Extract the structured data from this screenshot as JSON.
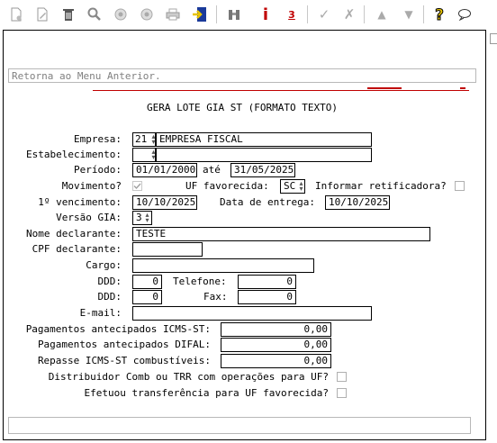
{
  "toolbar": {
    "icons": [
      "new-document-icon",
      "edit-icon",
      "trash-icon",
      "search-icon",
      "previous-icon",
      "next-icon",
      "print-icon",
      "exit-icon",
      "binoculars-icon",
      "info-icon",
      "sum-icon",
      "check-icon",
      "tools-icon",
      "up-arrow-icon",
      "down-arrow-icon",
      "help-icon",
      "chat-icon"
    ]
  },
  "message_bar": {
    "text": "Retorna ao Menu Anterior."
  },
  "form": {
    "title": "GERA LOTE GIA ST (FORMATO TEXTO)",
    "empresa": {
      "label": "Empresa:",
      "code": "21",
      "name": "EMPRESA FISCAL"
    },
    "estabelecimento": {
      "label": "Estabelecimento:",
      "code": "",
      "name": ""
    },
    "periodo": {
      "label": "Período:",
      "from": "01/01/2000",
      "sep": "até",
      "to": "31/05/2025"
    },
    "movimento": {
      "label": "Movimento?",
      "checked": true
    },
    "uf_favorecida": {
      "label": "UF favorecida:",
      "value": "SC"
    },
    "informar_retificadora": {
      "label": "Informar retificadora?",
      "checked": false
    },
    "vencimento": {
      "label": "1º vencimento:",
      "value": "10/10/2025"
    },
    "data_entrega": {
      "label": "Data de entrega:",
      "value": "10/10/2025"
    },
    "versao_gia": {
      "label": "Versão GIA:",
      "value": "3"
    },
    "nome_declarante": {
      "label": "Nome declarante:",
      "value": "TESTE"
    },
    "cpf_declarante": {
      "label": "CPF declarante:",
      "value": ""
    },
    "cargo": {
      "label": "Cargo:",
      "value": ""
    },
    "ddd1": {
      "label": "DDD:",
      "value": "0"
    },
    "telefone": {
      "label": "Telefone:",
      "value": "0"
    },
    "ddd2": {
      "label": "DDD:",
      "value": "0"
    },
    "fax": {
      "label": "Fax:",
      "value": "0"
    },
    "email": {
      "label": "E-mail:",
      "value": ""
    },
    "pag_icms_st": {
      "label": "Pagamentos antecipados ICMS-ST:",
      "value": "0,00"
    },
    "pag_difal": {
      "label": "Pagamentos antecipados DIFAL:",
      "value": "0,00"
    },
    "repasse": {
      "label": "Repasse ICMS-ST combustíveis:",
      "value": "0,00"
    },
    "distribuidor": {
      "label": "Distribuidor Comb ou TRR com operações para UF?",
      "checked": false
    },
    "transferencia": {
      "label": "Efetuou transferência para UF favorecida?",
      "checked": false
    }
  },
  "colors": {
    "accent_red": "#c00000",
    "help_yellow": "#e8c400",
    "exit_blue": "#1a3a9a"
  }
}
